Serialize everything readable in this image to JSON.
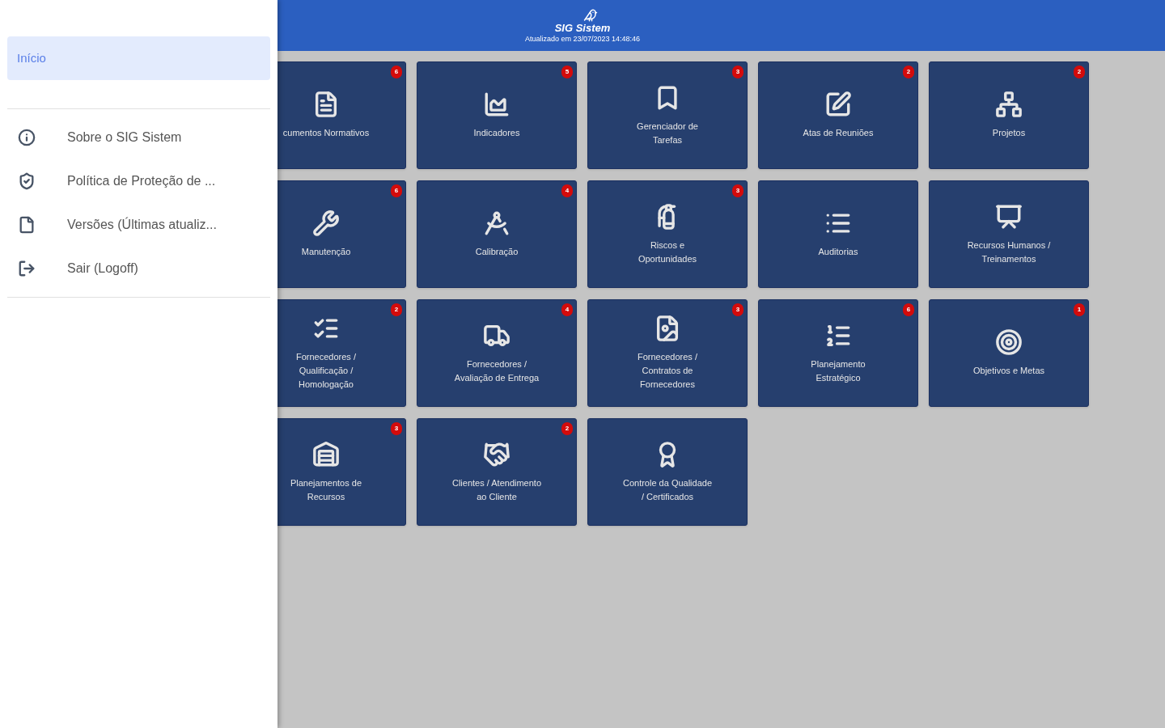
{
  "drawer": {
    "items": [
      {
        "label": "Início",
        "selected": true
      }
    ],
    "links": [
      {
        "label": "Sobre o SIG Sistem"
      },
      {
        "label": "Política de Proteção de ..."
      },
      {
        "label": "Versões (Últimas atualiz..."
      },
      {
        "label": "Sair (Logoff)"
      }
    ]
  },
  "header": {
    "logo": "SIG Sistem",
    "updated": "Atualizado em 23/07/2023 14:48:46"
  },
  "tiles": [
    {
      "label": "cumentos Normativos",
      "badge": "6"
    },
    {
      "label": "Indicadores",
      "badge": "5"
    },
    {
      "label": "Gerenciador de Tarefas",
      "badge": "3"
    },
    {
      "label": "Atas de Reuniões",
      "badge": "2"
    },
    {
      "label": "Projetos",
      "badge": "2"
    },
    {
      "label": "Manutenção",
      "badge": "6"
    },
    {
      "label": "Calibração",
      "badge": "4"
    },
    {
      "label": "Riscos e Oportunidades",
      "badge": "3"
    },
    {
      "label": "Auditorias"
    },
    {
      "label": "Recursos Humanos / Treinamentos"
    },
    {
      "label": "Fornecedores / Qualificação / Homologação",
      "badge": "2"
    },
    {
      "label": "Fornecedores / Avaliação de Entrega",
      "badge": "4"
    },
    {
      "label": "Fornecedores / Contratos de Fornecedores",
      "badge": "3"
    },
    {
      "label": "Planejamento Estratégico",
      "badge": "6"
    },
    {
      "label": "Objetivos e Metas",
      "badge": "1"
    },
    {
      "label": "Planejamentos de Recursos",
      "badge": "3"
    },
    {
      "label": "Clientes / Atendimento ao Cliente",
      "badge": "2"
    },
    {
      "label": "Controle da Qualidade / Certificados"
    }
  ]
}
